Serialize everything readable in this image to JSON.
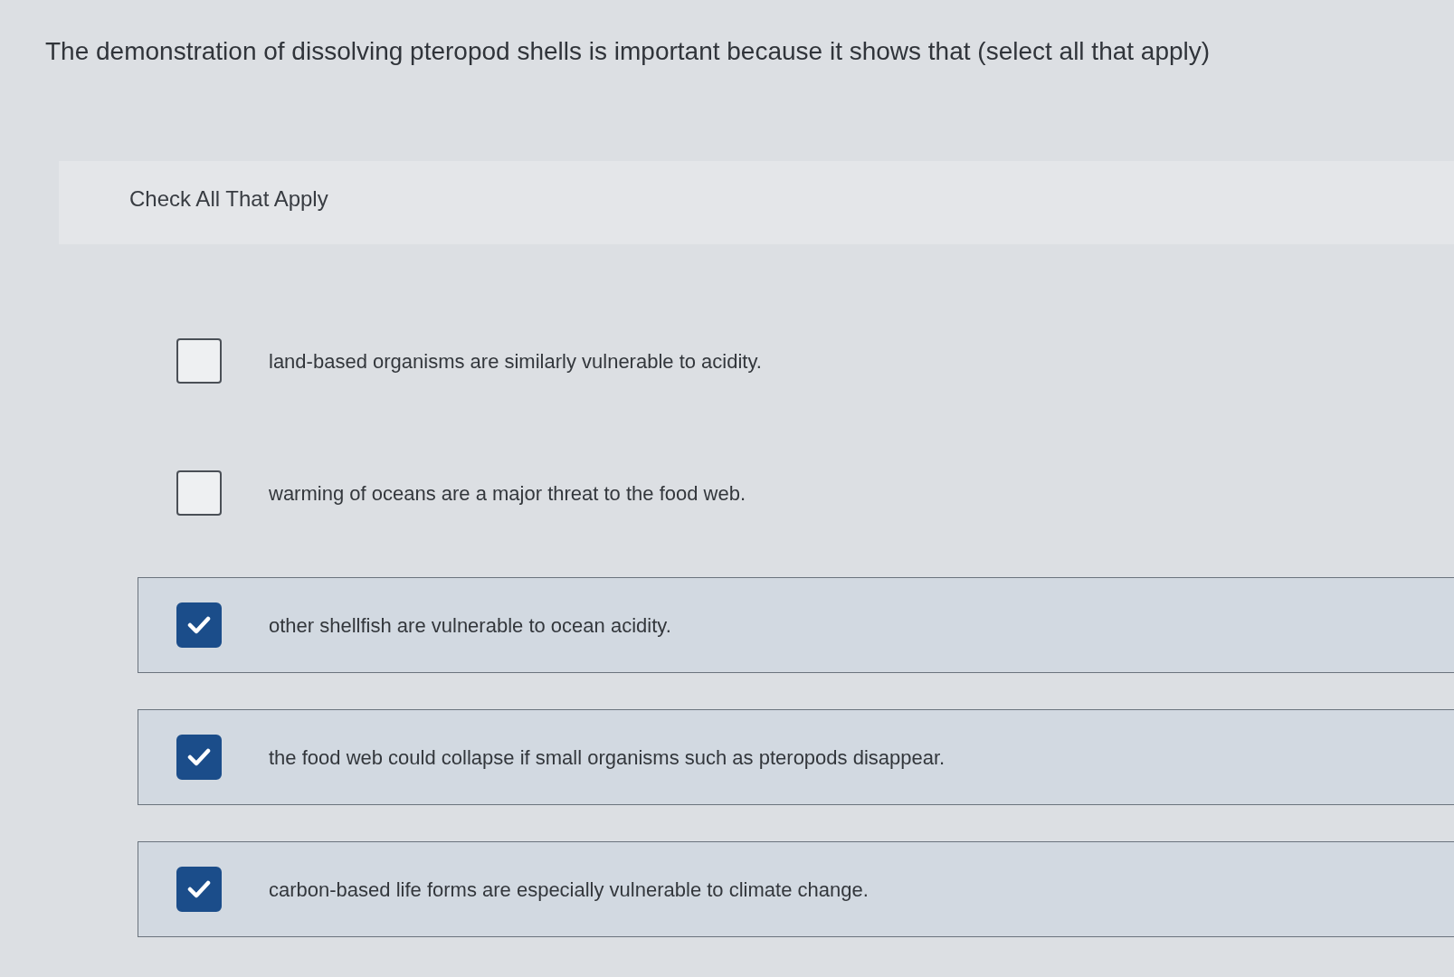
{
  "question": "The demonstration of dissolving pteropod shells is important because it shows that (select all that apply)",
  "instructions": "Check All That Apply",
  "options": [
    {
      "label": "land-based organisms are similarly vulnerable to acidity.",
      "checked": false
    },
    {
      "label": "warming of oceans are a major threat to the food web.",
      "checked": false
    },
    {
      "label": "other shellfish are vulnerable to ocean acidity.",
      "checked": true
    },
    {
      "label": "the food web could collapse if small organisms such as pteropods disappear.",
      "checked": true
    },
    {
      "label": "carbon-based life forms are especially vulnerable to climate change.",
      "checked": true
    }
  ]
}
